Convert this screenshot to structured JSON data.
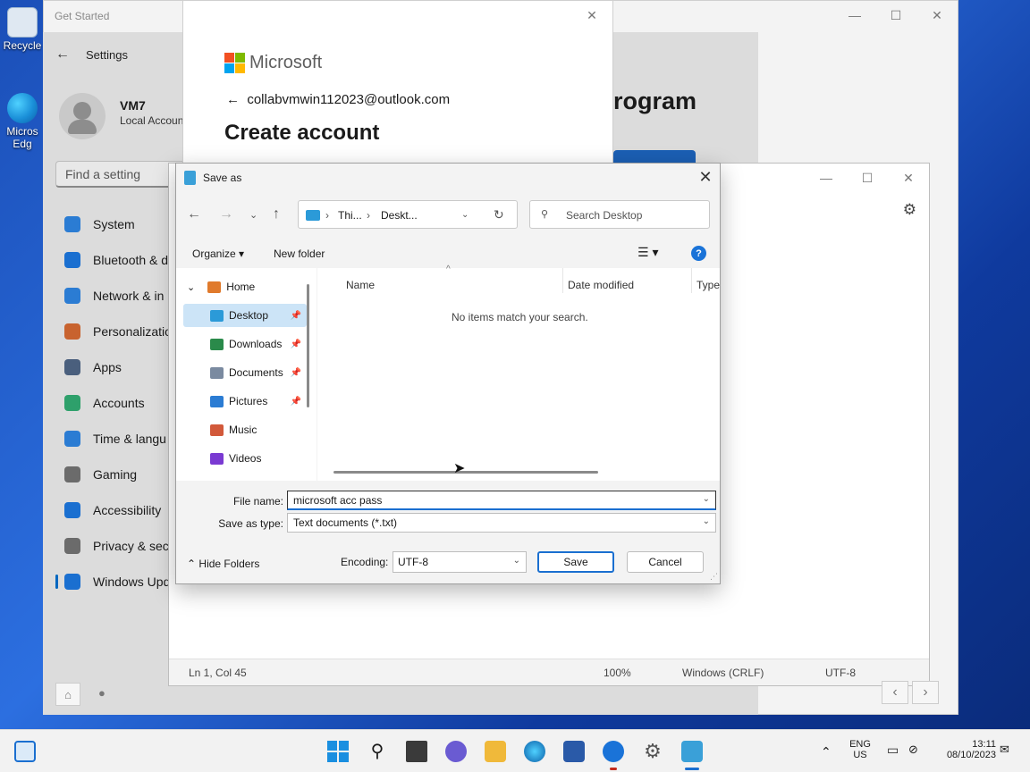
{
  "desktop": {
    "recycle_label": "Recycle",
    "edge_label_1": "Micros",
    "edge_label_2": "Edg"
  },
  "get_started": {
    "title": "Get Started",
    "program_heading": "rogram"
  },
  "settings": {
    "title": "Settings",
    "user_name": "VM7",
    "user_type": "Local Accoun",
    "search_placeholder": "Find a setting",
    "nav": [
      {
        "label": "System",
        "color": "#2b7cd3"
      },
      {
        "label": "Bluetooth & d",
        "color": "#1a6fd0"
      },
      {
        "label": "Network & in",
        "color": "#2b7cd3"
      },
      {
        "label": "Personalizatio",
        "color": "#c8632f"
      },
      {
        "label": "Apps",
        "color": "#4a5f7d"
      },
      {
        "label": "Accounts",
        "color": "#2ea06b"
      },
      {
        "label": "Time & langu",
        "color": "#2b7cd3"
      },
      {
        "label": "Gaming",
        "color": "#6b6b6b"
      },
      {
        "label": "Accessibility",
        "color": "#1a6fd0"
      },
      {
        "label": "Privacy & sec",
        "color": "#6b6b6b"
      },
      {
        "label": "Windows Upd",
        "color": "#1a6fd0"
      }
    ]
  },
  "ms_account": {
    "brand": "Microsoft",
    "email": "collabvmwin112023@outlook.com",
    "heading": "Create account"
  },
  "notepad": {
    "status": {
      "position": "Ln 1, Col 45",
      "zoom": "100%",
      "line_ending": "Windows (CRLF)",
      "encoding": "UTF-8"
    }
  },
  "save_as": {
    "title": "Save as",
    "address": {
      "part1": "Thi...",
      "part2": "Deskt..."
    },
    "search_placeholder": "Search Desktop",
    "organize_label": "Organize",
    "new_folder_label": "New folder",
    "tree": [
      {
        "label": "Home",
        "color": "#e07a2c",
        "pinned": false
      },
      {
        "label": "Desktop",
        "color": "#2b9ad8",
        "pinned": true
      },
      {
        "label": "Downloads",
        "color": "#2a8a4a",
        "pinned": true
      },
      {
        "label": "Documents",
        "color": "#7a8aa0",
        "pinned": true
      },
      {
        "label": "Pictures",
        "color": "#2b7cd3",
        "pinned": true
      },
      {
        "label": "Music",
        "color": "#d2593a",
        "pinned": false
      },
      {
        "label": "Videos",
        "color": "#7a3ad2",
        "pinned": false
      }
    ],
    "columns": {
      "name": "Name",
      "date": "Date modified",
      "type": "Type"
    },
    "empty_message": "No items match your search.",
    "file_name_label": "File name:",
    "file_name_value": "microsoft acc pass",
    "save_type_label": "Save as type:",
    "save_type_value": "Text documents (*.txt)",
    "hide_folders_label": "Hide Folders",
    "encoding_label": "Encoding:",
    "encoding_value": "UTF-8",
    "save_label": "Save",
    "cancel_label": "Cancel"
  },
  "taskbar": {
    "lang_1": "ENG",
    "lang_2": "US",
    "time": "13:11",
    "date": "08/10/2023"
  }
}
